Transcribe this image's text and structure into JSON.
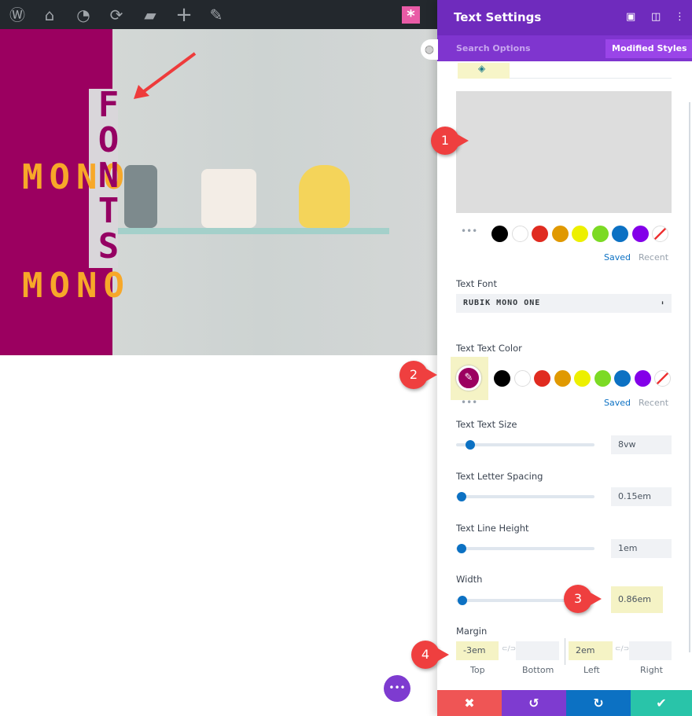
{
  "admin_bar": {
    "icons": [
      "wordpress-icon",
      "sites-icon",
      "dashboard-icon",
      "refresh-icon",
      "comment-icon",
      "plus-icon",
      "pencil-icon",
      "divi-star-icon"
    ]
  },
  "preview": {
    "vertical_text": [
      "F",
      "O",
      "N",
      "T",
      "S"
    ],
    "mono_1": "MONO",
    "mono_2": "MONO",
    "colors": {
      "block": "#9b0060",
      "vertical": "#950063",
      "mono": "#f7a829"
    }
  },
  "panel": {
    "title": "Text Settings",
    "search_placeholder": "Search Options",
    "modified_styles": "Modified Styles",
    "bg_saved": "Saved",
    "bg_recent": "Recent",
    "palette": [
      "#000000",
      "#ffffff",
      "#e02b20",
      "#e09900",
      "#edf000",
      "#7cda24",
      "#0c71c3",
      "#8300e9"
    ],
    "text_font_label": "Text Font",
    "text_font_value": "RUBIK MONO ONE",
    "text_color_label": "Text Text Color",
    "text_color_value": "#9b0060",
    "color_saved": "Saved",
    "color_recent": "Recent",
    "size_label": "Text Text Size",
    "size_value": "8vw",
    "spacing_label": "Text Letter Spacing",
    "spacing_value": "0.15em",
    "line_label": "Text Line Height",
    "line_value": "1em",
    "width_label": "Width",
    "width_value": "0.86em",
    "margin_label": "Margin",
    "margin_top": "-3em",
    "margin_bottom": "",
    "margin_left": "2em",
    "margin_right": "",
    "margin_top_label": "Top",
    "margin_bottom_label": "Bottom",
    "margin_left_label": "Left",
    "margin_right_label": "Right"
  },
  "annotations": [
    "1",
    "2",
    "3",
    "4"
  ],
  "footer": {
    "cancel": "✖",
    "undo": "↺",
    "redo": "↻",
    "save": "✔"
  },
  "fab_label": "•••"
}
